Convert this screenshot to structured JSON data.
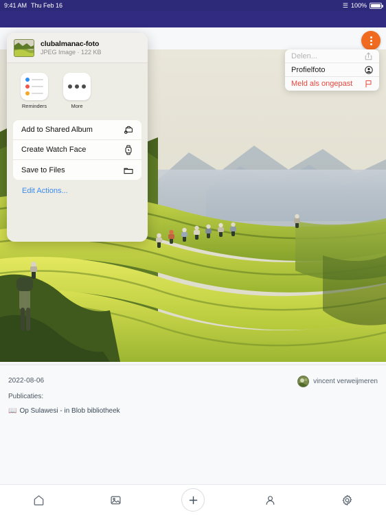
{
  "status_bar": {
    "time": "9:41 AM",
    "date": "Thu Feb 16",
    "wifi_icon": "wifi-icon",
    "battery_percent": "100%",
    "battery_icon": "battery-full-icon"
  },
  "header": {
    "overflow_icon": "more-horizontal-icon",
    "background_color": "#322b82"
  },
  "fab": {
    "icon": "more-vertical-icon",
    "color": "#f06a20"
  },
  "context_menu": {
    "items": [
      {
        "label": "Delen...",
        "icon": "share-icon",
        "state": "disabled"
      },
      {
        "label": "Profielfoto",
        "icon": "person-circle-icon",
        "state": "normal"
      },
      {
        "label": "Meld als ongepast",
        "icon": "flag-icon",
        "state": "danger"
      }
    ],
    "danger_color": "#e8453c"
  },
  "share_sheet": {
    "file_name": "clubalmanac-foto",
    "file_meta": "JPEG Image · 122 KB",
    "thumbnail_icon": "photo-thumbnail",
    "apps": [
      {
        "label": "Reminders",
        "icon": "reminders-icon"
      },
      {
        "label": "More",
        "icon": "more-icon"
      }
    ],
    "actions": [
      {
        "label": "Add to Shared Album",
        "icon": "shared-album-icon"
      },
      {
        "label": "Create Watch Face",
        "icon": "watch-icon"
      },
      {
        "label": "Save to Files",
        "icon": "folder-icon"
      }
    ],
    "edit_actions_label": "Edit Actions...",
    "edit_actions_color": "#3b8bf0"
  },
  "photo": {
    "alt": "rice terraces with hikers",
    "caption_icon": "landscape-photo"
  },
  "meta": {
    "date": "2022-08-06",
    "publications_label": "Publicaties:",
    "publication_link": "Op Sulawesi - in Blob bibliotheek",
    "publication_icon": "books-icon",
    "author_name": "vincent verweijmeren",
    "author_avatar_icon": "avatar-image"
  },
  "tabbar": {
    "items": [
      {
        "name": "home",
        "icon": "home-icon"
      },
      {
        "name": "gallery",
        "icon": "image-icon"
      },
      {
        "name": "add",
        "icon": "plus-icon"
      },
      {
        "name": "profile",
        "icon": "person-icon"
      },
      {
        "name": "settings",
        "icon": "gear-icon"
      }
    ]
  }
}
